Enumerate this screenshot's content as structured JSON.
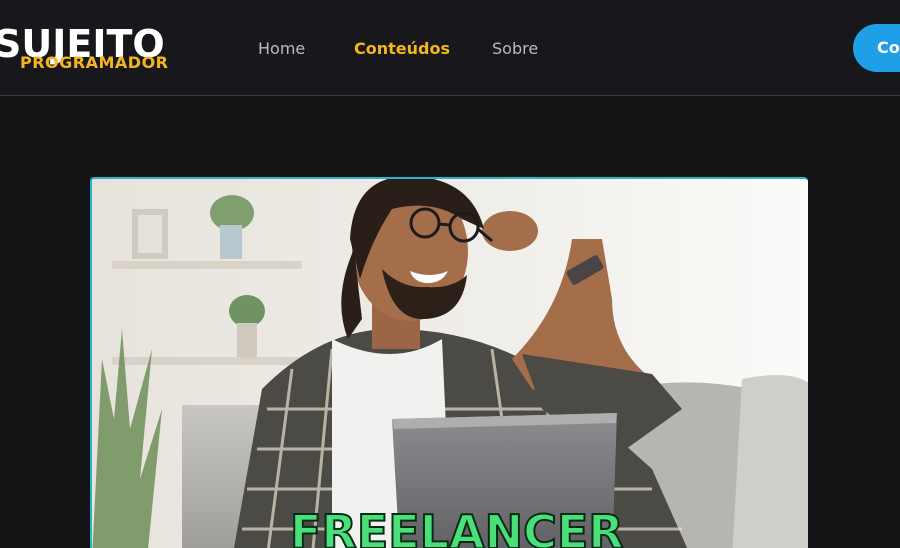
{
  "logo": {
    "top_text": "SUJEITO",
    "bottom_text": "PROGRAMADOR"
  },
  "nav": {
    "items": [
      {
        "label": "Home",
        "active": false
      },
      {
        "label": "Conteúdos",
        "active": true
      },
      {
        "label": "Sobre",
        "active": false
      }
    ]
  },
  "cta": {
    "label": "Co"
  },
  "hero": {
    "caption": "FREELANCER"
  },
  "colors": {
    "background": "#131316",
    "accent_yellow": "#f3b61f",
    "accent_blue": "#1f9fe6",
    "caption_green": "#49e07a"
  },
  "icons": {
    "hero_image": "man-with-laptop-photo"
  }
}
